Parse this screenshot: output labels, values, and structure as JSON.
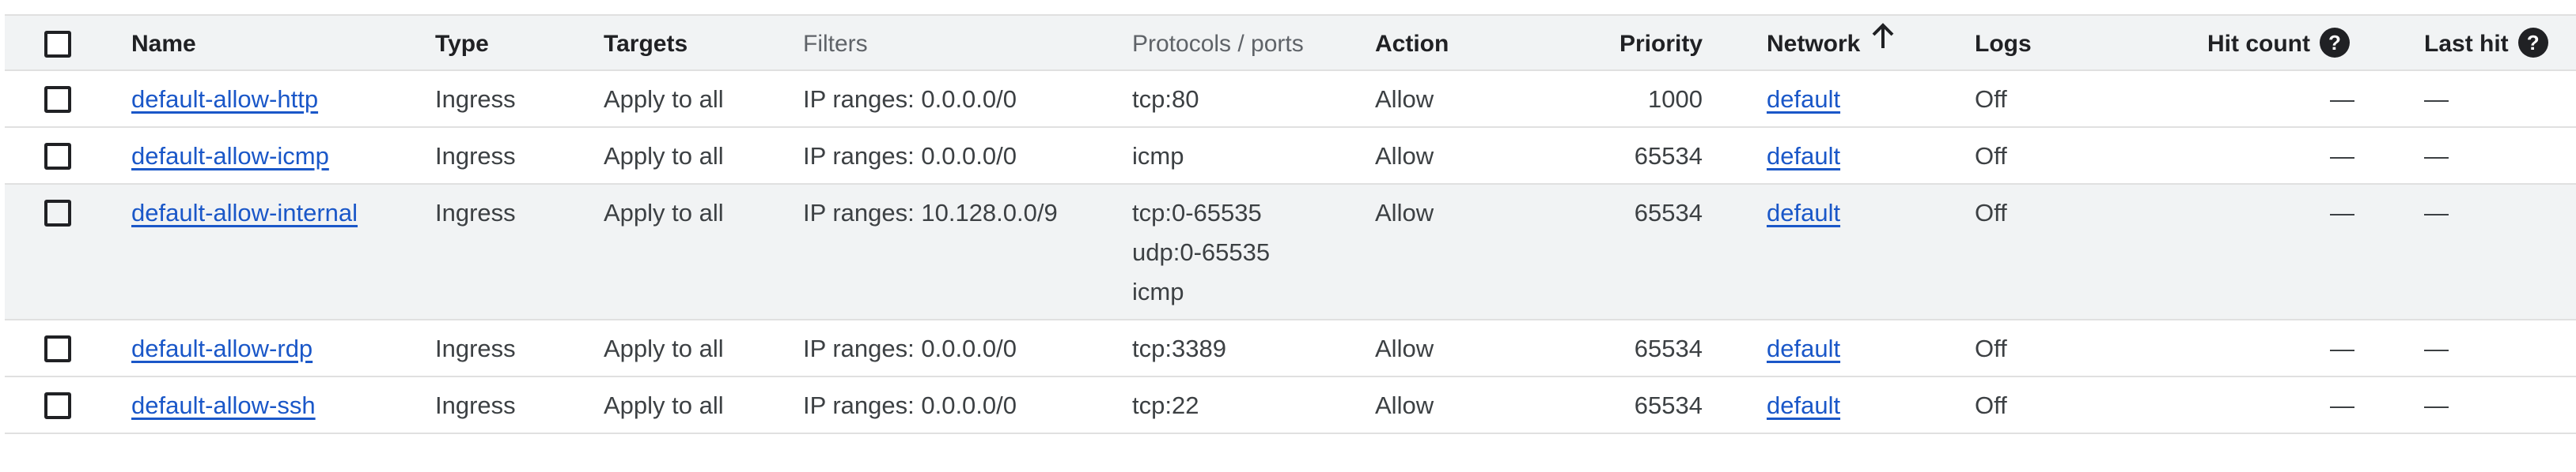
{
  "header": {
    "name": "Name",
    "type": "Type",
    "targets": "Targets",
    "filters": "Filters",
    "protocols": "Protocols / ports",
    "action": "Action",
    "priority": "Priority",
    "network": "Network",
    "logs": "Logs",
    "hit_count": "Hit count",
    "last_hit": "Last hit",
    "help_glyph": "?"
  },
  "rows": [
    {
      "name": "default-allow-http",
      "type": "Ingress",
      "targets": "Apply to all",
      "filters": "IP ranges: 0.0.0.0/0",
      "protocols": [
        "tcp:80"
      ],
      "action": "Allow",
      "priority": "1000",
      "network": "default",
      "logs": "Off",
      "hit_count": "—",
      "last_hit": "—"
    },
    {
      "name": "default-allow-icmp",
      "type": "Ingress",
      "targets": "Apply to all",
      "filters": "IP ranges: 0.0.0.0/0",
      "protocols": [
        "icmp"
      ],
      "action": "Allow",
      "priority": "65534",
      "network": "default",
      "logs": "Off",
      "hit_count": "—",
      "last_hit": "—"
    },
    {
      "name": "default-allow-internal",
      "type": "Ingress",
      "targets": "Apply to all",
      "filters": "IP ranges: 10.128.0.0/9",
      "protocols": [
        "tcp:0-65535",
        "udp:0-65535",
        "icmp"
      ],
      "action": "Allow",
      "priority": "65534",
      "network": "default",
      "logs": "Off",
      "hit_count": "—",
      "last_hit": "—"
    },
    {
      "name": "default-allow-rdp",
      "type": "Ingress",
      "targets": "Apply to all",
      "filters": "IP ranges: 0.0.0.0/0",
      "protocols": [
        "tcp:3389"
      ],
      "action": "Allow",
      "priority": "65534",
      "network": "default",
      "logs": "Off",
      "hit_count": "—",
      "last_hit": "—"
    },
    {
      "name": "default-allow-ssh",
      "type": "Ingress",
      "targets": "Apply to all",
      "filters": "IP ranges: 0.0.0.0/0",
      "protocols": [
        "tcp:22"
      ],
      "action": "Allow",
      "priority": "65534",
      "network": "default",
      "logs": "Off",
      "hit_count": "—",
      "last_hit": "—"
    }
  ],
  "colors": {
    "link": "#1a57c8",
    "header_bg": "#f1f3f4",
    "border": "#e0e0e0",
    "text": "#3c4043"
  }
}
